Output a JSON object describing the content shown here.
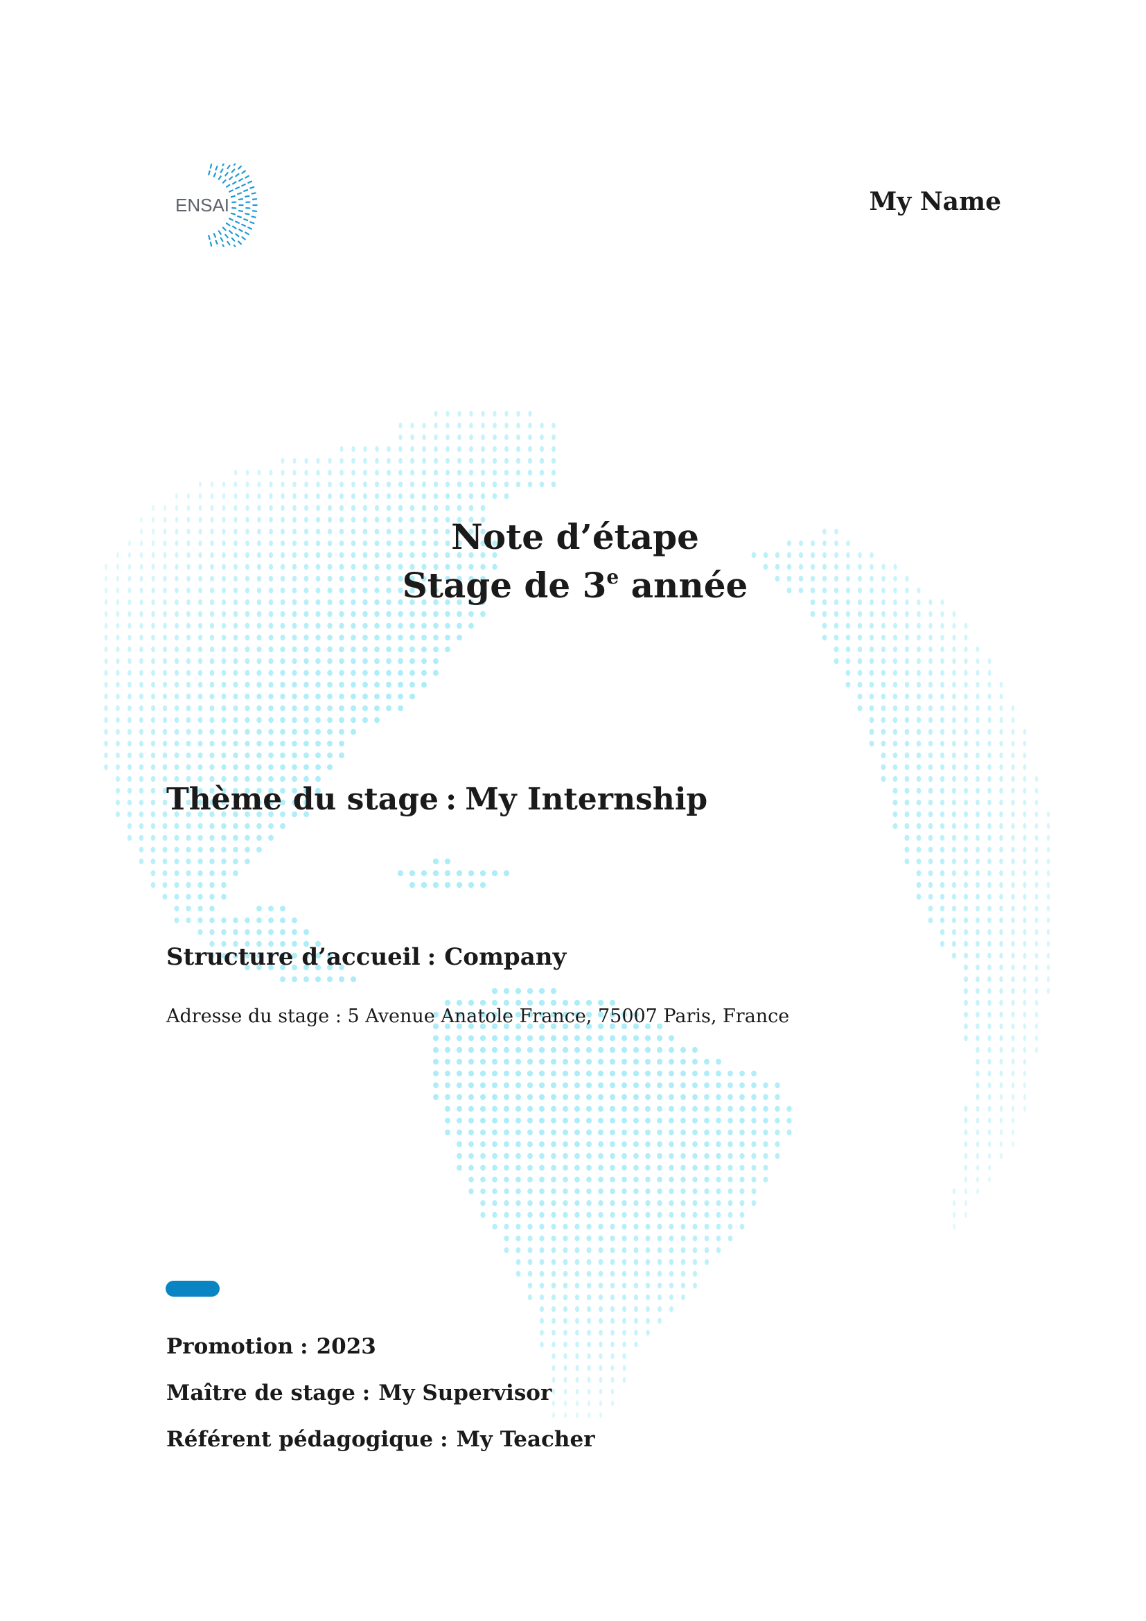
{
  "logo": {
    "text": "ENSAI"
  },
  "author": "My Name",
  "title": {
    "line1": "Note d’étape",
    "line2_prefix": "Stage de 3",
    "line2_sup": "e",
    "line2_suffix": "année"
  },
  "theme": {
    "label": "Thème du stage",
    "value": "My Internship"
  },
  "structure": {
    "label": "Structure d’accueil",
    "value": "Company"
  },
  "address": {
    "label": "Adresse du stage :",
    "value": "5 Avenue Anatole France, 75007 Paris, France"
  },
  "promotion": {
    "label": "Promotion",
    "value": "2023"
  },
  "supervisor": {
    "label": "Maître de stage",
    "value": "My Supervisor"
  },
  "teacher": {
    "label": "Référent pédagogique",
    "value": "My Teacher"
  },
  "colors": {
    "accent": "#0a84c2",
    "globe_dots": "#a8ecf7",
    "logo_dots": "#1d9ad6",
    "text": "#1a1a1a"
  }
}
